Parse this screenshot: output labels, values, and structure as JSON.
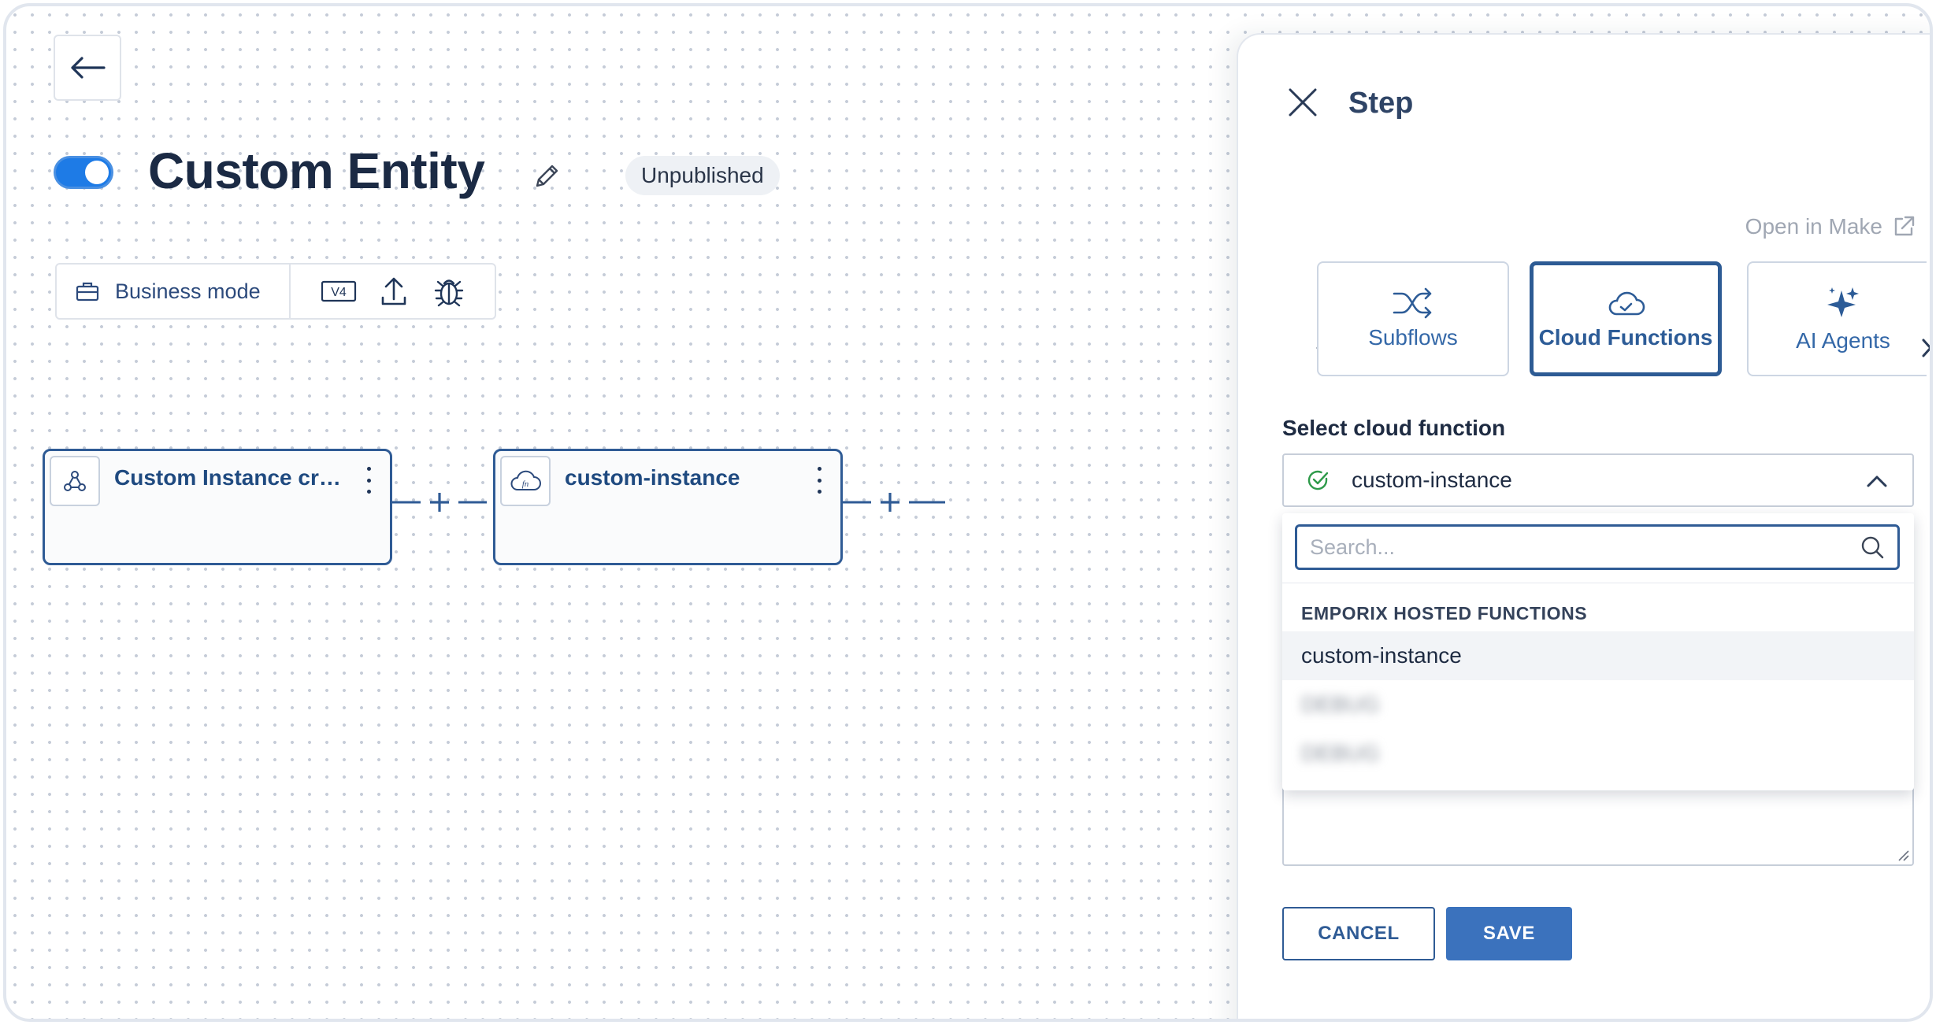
{
  "flow": {
    "title": "Custom Entity",
    "status": "Unpublished",
    "enabled": true
  },
  "toolbar": {
    "mode_label": "Business mode",
    "version_label": "V4"
  },
  "nodes": [
    {
      "title": "Custom Instance crea...",
      "icon": "webhook-icon"
    },
    {
      "title": "custom-instance",
      "icon": "cloud-function-icon"
    }
  ],
  "panel": {
    "title": "Step",
    "open_link": "Open in Make",
    "tabs": [
      {
        "label": "Subflows",
        "icon": "shuffle-icon",
        "active": false
      },
      {
        "label": "Cloud Functions",
        "icon": "cloud-check-icon",
        "active": true
      },
      {
        "label": "AI Agents",
        "icon": "sparkles-icon",
        "active": false
      }
    ],
    "field_label": "Select cloud function",
    "selected_value": "custom-instance",
    "search_placeholder": "Search...",
    "group_label": "EMPORIX HOSTED FUNCTIONS",
    "options": [
      "custom-instance",
      "DEBUG",
      "DEBUG"
    ],
    "cancel_label": "CANCEL",
    "save_label": "SAVE"
  },
  "colors": {
    "accent": "#2f5b95",
    "primary_button": "#3b72bd",
    "toggle": "#1e7be6"
  }
}
